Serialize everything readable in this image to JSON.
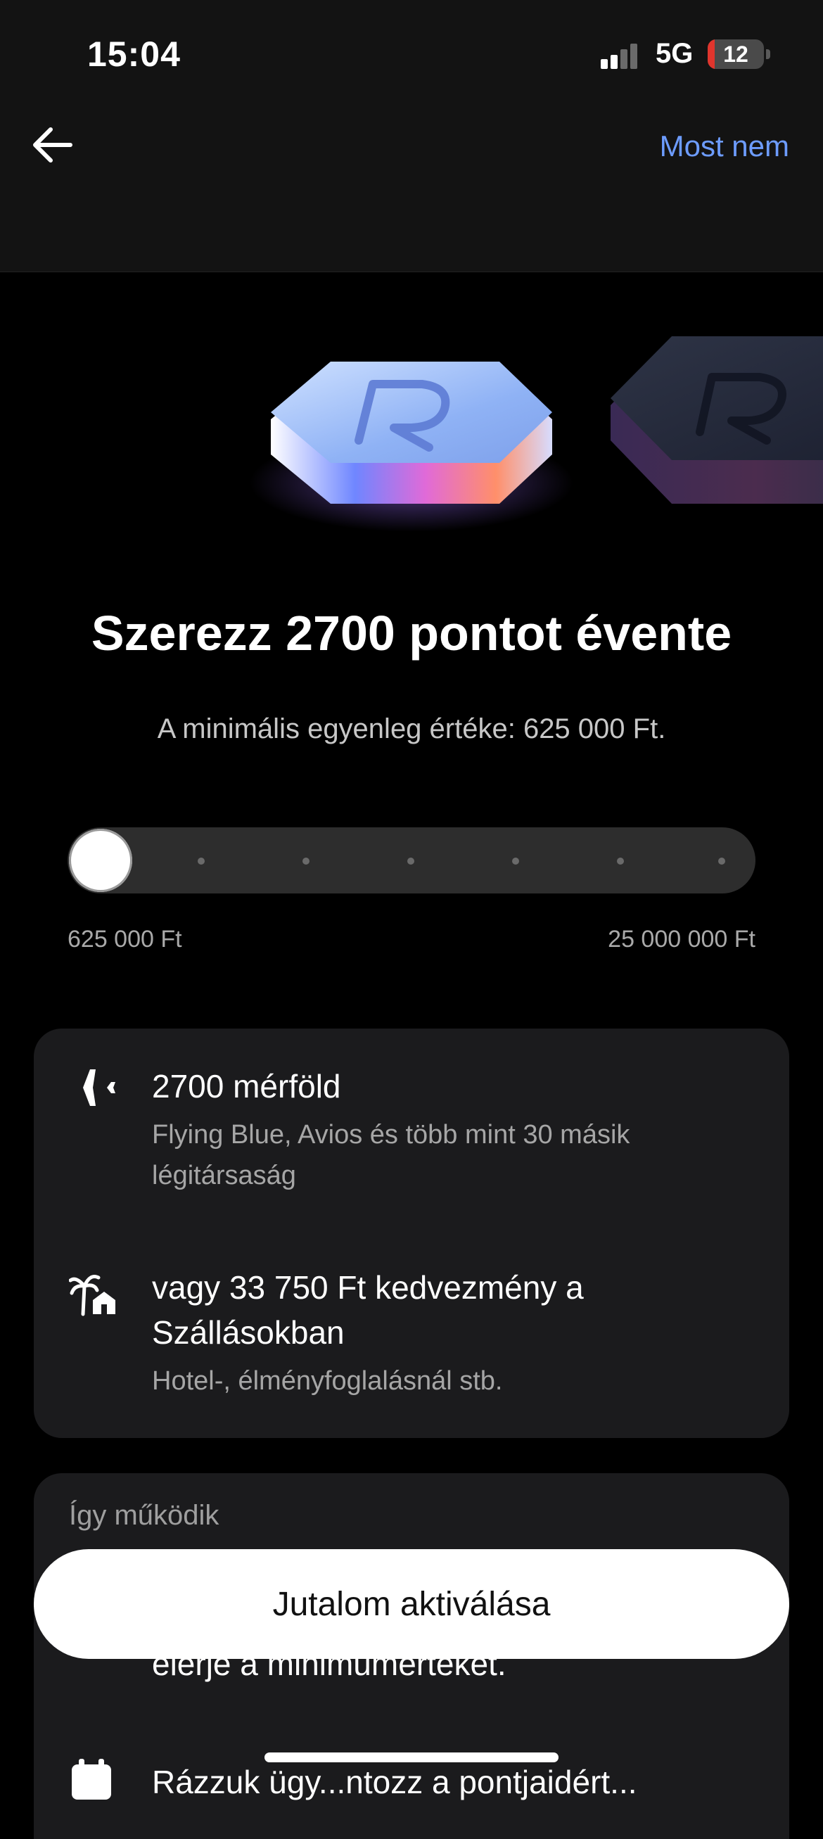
{
  "status_bar": {
    "time": "15:04",
    "network": "5G",
    "battery_level": "12",
    "battery_fraction": 0.12
  },
  "nav": {
    "dismiss_label": "Most nem",
    "accent_color": "#6d9cff"
  },
  "hero": {
    "title": "Szerezz 2700 pontot évente",
    "subtitle": "A minimális egyenleg értéke: 625 000 Ft."
  },
  "slider": {
    "min_label": "625 000 Ft",
    "max_label": "25 000 000 Ft",
    "value_fraction": 0,
    "steps": 7
  },
  "benefits": [
    {
      "icon": "airplane-icon",
      "title": "2700 mérföld",
      "subtitle": "Flying Blue, Avios és több mint 30 másik légitársaság"
    },
    {
      "icon": "hotel-icon",
      "title": "vagy 33 750 Ft kedvezmény a Szállásokban",
      "subtitle": "Hotel-, élményfoglalásnál stb."
    }
  ],
  "how_it_works": {
    "heading": "Így működik",
    "partial_text": "elérje a minimumértéket.",
    "partial_text_2": "Rázzuk ügy...ntozz a pontjaidért..."
  },
  "cta": {
    "label": "Jutalom aktiválása"
  }
}
